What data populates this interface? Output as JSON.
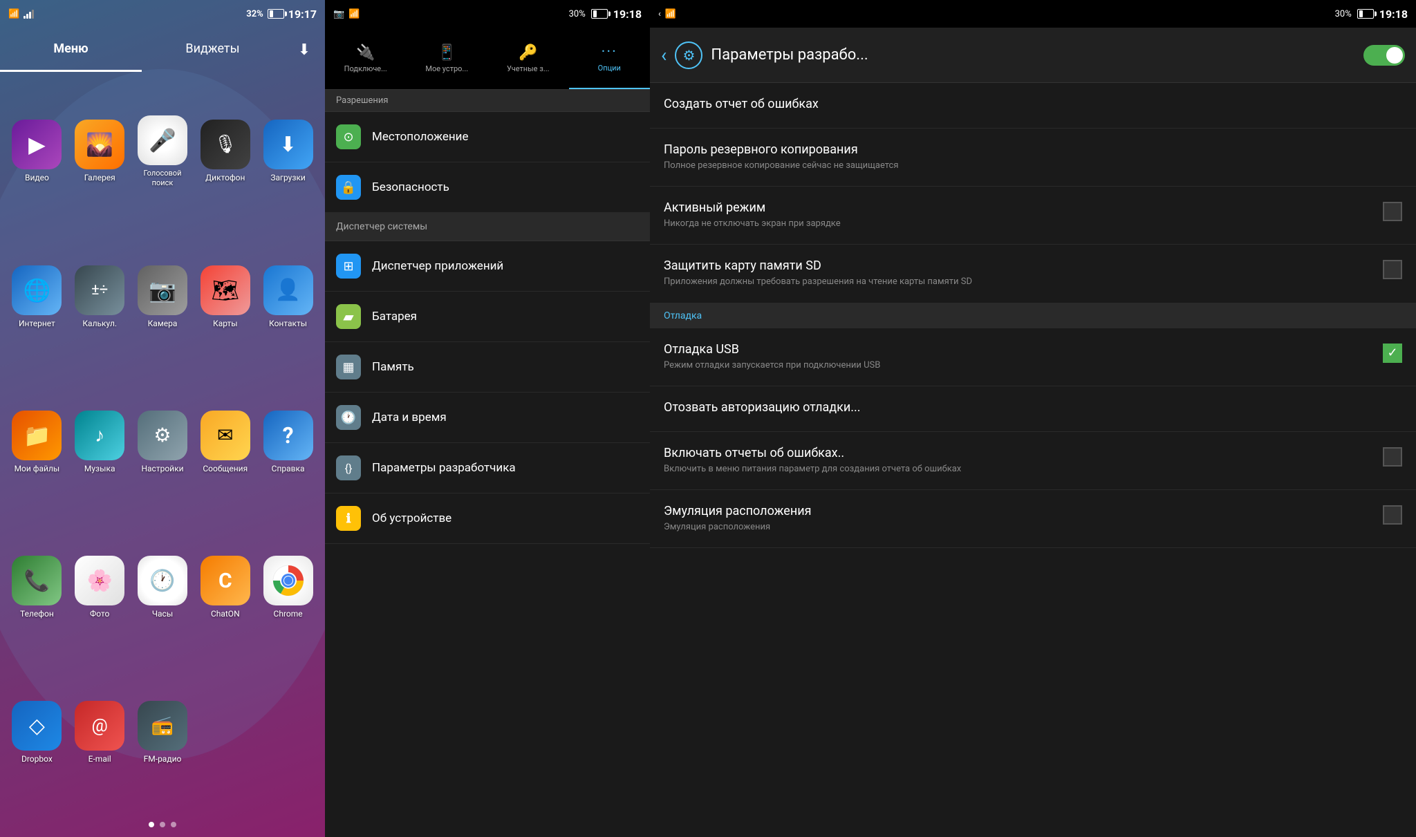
{
  "panel1": {
    "status": {
      "left_icons": "wifi signal",
      "battery": "32%",
      "time": "19:17"
    },
    "tabs": [
      {
        "label": "Меню",
        "active": true
      },
      {
        "label": "Виджеты",
        "active": false
      }
    ],
    "download_icon": "⬇",
    "apps": [
      {
        "id": "video",
        "label": "Видео",
        "icon": "▶",
        "bg": "bg-video"
      },
      {
        "id": "gallery",
        "label": "Галерея",
        "icon": "🖼",
        "bg": "bg-gallery"
      },
      {
        "id": "voice",
        "label": "Голосовой поиск",
        "icon": "🎤",
        "bg": "bg-voice"
      },
      {
        "id": "recorder",
        "label": "Диктофон",
        "icon": "⬛",
        "bg": "bg-recorder"
      },
      {
        "id": "downloads",
        "label": "Загрузки",
        "icon": "⬇",
        "bg": "bg-downloads"
      },
      {
        "id": "internet",
        "label": "Интернет",
        "icon": "🌐",
        "bg": "bg-internet"
      },
      {
        "id": "calc",
        "label": "Калькул.",
        "icon": "±",
        "bg": "bg-calc"
      },
      {
        "id": "camera",
        "label": "Камера",
        "icon": "📷",
        "bg": "bg-camera"
      },
      {
        "id": "maps",
        "label": "Карты",
        "icon": "📍",
        "bg": "bg-maps"
      },
      {
        "id": "contacts",
        "label": "Контакты",
        "icon": "👤",
        "bg": "bg-contacts"
      },
      {
        "id": "myfiles",
        "label": "Мои файлы",
        "icon": "📁",
        "bg": "bg-myfiles"
      },
      {
        "id": "music",
        "label": "Музыка",
        "icon": "♪",
        "bg": "bg-music"
      },
      {
        "id": "settings",
        "label": "Настройки",
        "icon": "⚙",
        "bg": "bg-settings"
      },
      {
        "id": "messages",
        "label": "Сообщения",
        "icon": "✉",
        "bg": "bg-messages"
      },
      {
        "id": "help",
        "label": "Справка",
        "icon": "?",
        "bg": "bg-help"
      },
      {
        "id": "phone",
        "label": "Телефон",
        "icon": "📞",
        "bg": "bg-phone"
      },
      {
        "id": "photos",
        "label": "Фото",
        "icon": "🌸",
        "bg": "bg-photos"
      },
      {
        "id": "clock",
        "label": "Часы",
        "icon": "🕐",
        "bg": "bg-clock"
      },
      {
        "id": "chaton",
        "label": "ChatON",
        "icon": "C",
        "bg": "bg-chaton"
      },
      {
        "id": "chrome",
        "label": "Chrome",
        "icon": "◉",
        "bg": "bg-chrome"
      },
      {
        "id": "dropbox",
        "label": "Dropbox",
        "icon": "◇",
        "bg": "bg-dropbox"
      },
      {
        "id": "email",
        "label": "E-mail",
        "icon": "@",
        "bg": "bg-email"
      },
      {
        "id": "fmradio",
        "label": "FM-радио",
        "icon": "📻",
        "bg": "bg-fmradio"
      },
      {
        "id": "empty1",
        "label": "",
        "icon": "",
        "bg": ""
      },
      {
        "id": "empty2",
        "label": "",
        "icon": "",
        "bg": ""
      }
    ],
    "dots": [
      1,
      2,
      3
    ],
    "active_dot": 1
  },
  "panel2": {
    "status": {
      "battery": "30%",
      "time": "19:18"
    },
    "tabs": [
      {
        "label": "Подключе...",
        "icon": "🔌",
        "active": false
      },
      {
        "label": "Мое устро...",
        "icon": "📱",
        "active": false
      },
      {
        "label": "Учетные з...",
        "icon": "🔑",
        "active": false
      },
      {
        "label": "Опции",
        "icon": "⋯",
        "active": true
      }
    ],
    "section_header": "Разрешения",
    "items": [
      {
        "id": "location",
        "label": "Местоположение",
        "icon": "⊙",
        "icon_bg": "si-green",
        "highlighted": false
      },
      {
        "id": "security",
        "label": "Безопасность",
        "icon": "🔒",
        "icon_bg": "si-blue",
        "highlighted": false
      },
      {
        "id": "sysmgr",
        "label": "Диспетчер системы",
        "icon": "",
        "icon_bg": "",
        "highlighted": true,
        "is_section": true
      },
      {
        "id": "appman",
        "label": "Диспетчер приложений",
        "icon": "⊞",
        "icon_bg": "si-blue",
        "highlighted": false
      },
      {
        "id": "battery",
        "label": "Батарея",
        "icon": "▰",
        "icon_bg": "si-lime",
        "highlighted": false
      },
      {
        "id": "memory",
        "label": "Память",
        "icon": "▦",
        "icon_bg": "si-gray",
        "highlighted": false
      },
      {
        "id": "datetime",
        "label": "Дата и время",
        "icon": "🕐",
        "icon_bg": "",
        "highlighted": false
      },
      {
        "id": "devopt",
        "label": "Параметры разработчика",
        "icon": "{}",
        "icon_bg": "si-gray",
        "highlighted": false
      },
      {
        "id": "about",
        "label": "Об устройстве",
        "icon": "ℹ",
        "icon_bg": "si-yellow",
        "highlighted": false
      }
    ]
  },
  "panel3": {
    "status": {
      "battery": "30%",
      "time": "19:18"
    },
    "header": {
      "title": "Параметры разрабо...",
      "toggle_on": true
    },
    "items": [
      {
        "id": "bug-report",
        "title": "Создать отчет об ошибках",
        "subtitle": "",
        "checkbox": false,
        "has_checkbox": false,
        "is_section": false
      },
      {
        "id": "backup-pwd",
        "title": "Пароль резервного копирования",
        "subtitle": "Полное резервное копирование сейчас не защищается",
        "checkbox": false,
        "has_checkbox": false,
        "is_section": false
      },
      {
        "id": "active-mode",
        "title": "Активный режим",
        "subtitle": "Никогда не отключать экран при зарядке",
        "checkbox": false,
        "has_checkbox": true,
        "is_section": false
      },
      {
        "id": "protect-sd",
        "title": "Защитить карту памяти SD",
        "subtitle": "Приложения должны требовать разрешения на чтение карты памяти SD",
        "checkbox": false,
        "has_checkbox": true,
        "is_section": false
      },
      {
        "id": "debug-section",
        "title": "Отладка",
        "subtitle": "",
        "checkbox": false,
        "has_checkbox": false,
        "is_section": true
      },
      {
        "id": "usb-debug",
        "title": "Отладка USB",
        "subtitle": "Режим отладки запускается при подключении USB",
        "checkbox": true,
        "has_checkbox": true,
        "is_section": false
      },
      {
        "id": "revoke-debug",
        "title": "Отозвать авторизацию отладки...",
        "subtitle": "",
        "checkbox": false,
        "has_checkbox": false,
        "is_section": false
      },
      {
        "id": "error-reports",
        "title": "Включать отчеты об ошибках..",
        "subtitle": "Включить в меню питания параметр для создания отчета об ошибках",
        "checkbox": false,
        "has_checkbox": true,
        "is_section": false
      },
      {
        "id": "mock-location",
        "title": "Эмуляция расположения",
        "subtitle": "Эмуляция расположения",
        "checkbox": false,
        "has_checkbox": true,
        "is_section": false
      }
    ]
  }
}
